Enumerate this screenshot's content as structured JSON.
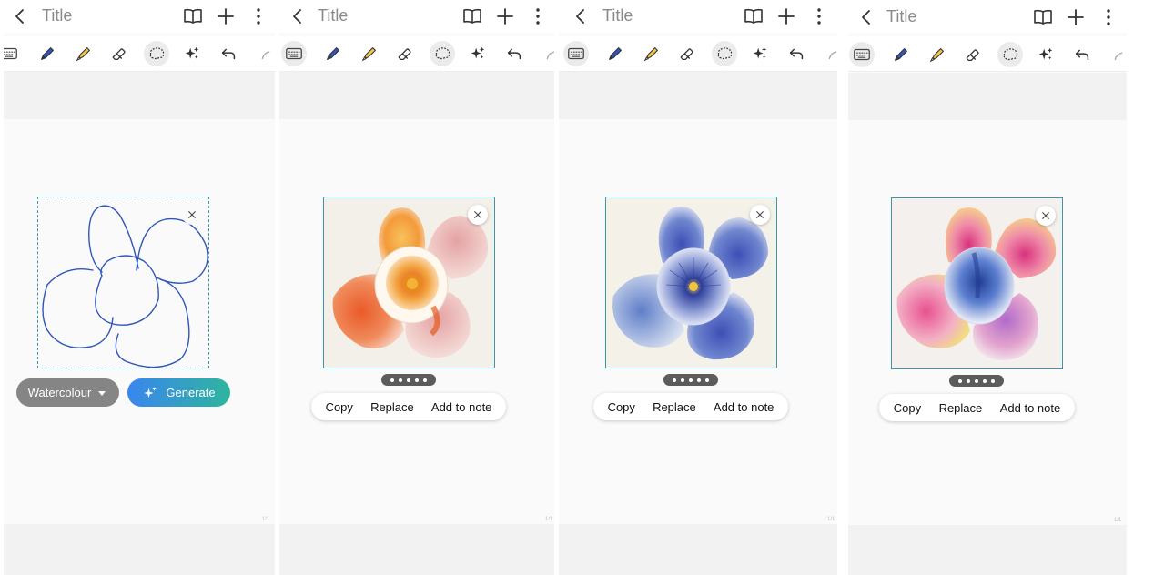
{
  "header": {
    "title": "Title"
  },
  "actions": {
    "copy": "Copy",
    "replace": "Replace",
    "add_to_note": "Add to note"
  },
  "sketch_panel": {
    "style_label": "Watercolour",
    "generate_label": "Generate"
  },
  "page_number": "1/1",
  "colors": {
    "accent_frame": "#3f95a6",
    "generate_start": "#3a86ee",
    "generate_end": "#2fb59e",
    "sketch_stroke": "#2f55b8"
  },
  "generated_images": [
    {
      "variant": "orange-watercolour-flower"
    },
    {
      "variant": "blue-pansy-watercolour-flower"
    },
    {
      "variant": "pink-blue-watercolour-flower"
    }
  ]
}
